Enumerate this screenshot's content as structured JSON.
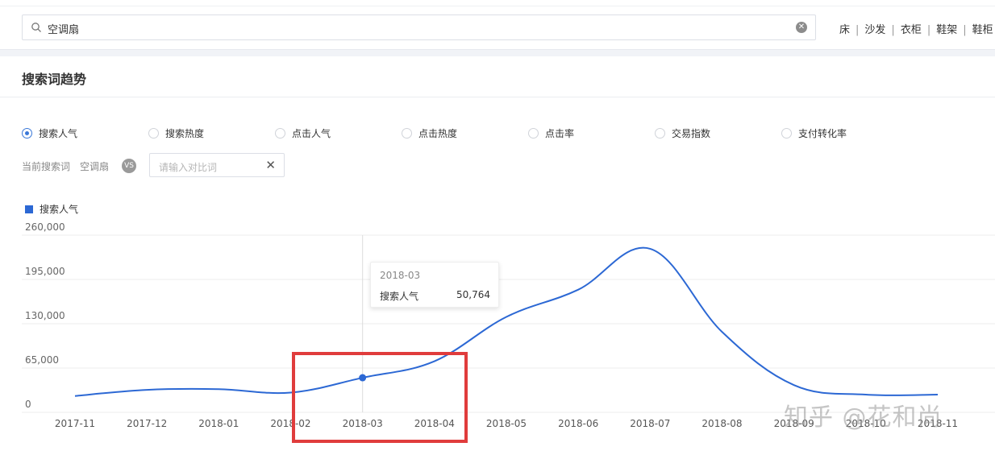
{
  "search": {
    "value": "空调扇"
  },
  "quick_links": [
    "床",
    "沙发",
    "衣柜",
    "鞋架",
    "鞋柜"
  ],
  "section_title": "搜索词趋势",
  "metrics": [
    {
      "label": "搜索人气",
      "selected": true
    },
    {
      "label": "搜索热度",
      "selected": false
    },
    {
      "label": "点击人气",
      "selected": false
    },
    {
      "label": "点击热度",
      "selected": false
    },
    {
      "label": "点击率",
      "selected": false
    },
    {
      "label": "交易指数",
      "selected": false
    },
    {
      "label": "支付转化率",
      "selected": false
    }
  ],
  "compare": {
    "current_label": "当前搜索词",
    "current_word": "空调扇",
    "vs": "VS",
    "placeholder": "请输入对比词",
    "clear": "✕"
  },
  "tooltip": {
    "title": "2018-03",
    "name": "搜索人气",
    "value": "50,764"
  },
  "watermark": "知乎 @花和尚",
  "colors": {
    "series": "#2c68d4",
    "highlight": "#e03c3c",
    "accent": "#3a78d8"
  },
  "chart_data": {
    "type": "line",
    "title": "",
    "legend_position": "top-left",
    "x": [
      "2017-11",
      "2017-12",
      "2018-01",
      "2018-02",
      "2018-03",
      "2018-04",
      "2018-05",
      "2018-06",
      "2018-07",
      "2018-08",
      "2018-09",
      "2018-10",
      "2018-11"
    ],
    "series": [
      {
        "name": "搜索人气",
        "values": [
          24000,
          33000,
          34000,
          29000,
          50764,
          75000,
          140000,
          180000,
          240000,
          118000,
          40000,
          26000,
          26000
        ]
      }
    ],
    "ylim": [
      0,
      260000
    ],
    "yticks": [
      "260,000",
      "195,000",
      "130,000",
      "65,000",
      "0"
    ],
    "yvalues": [
      260000,
      195000,
      130000,
      65000,
      0
    ],
    "highlighted_point": "2018-03",
    "grid": true
  }
}
